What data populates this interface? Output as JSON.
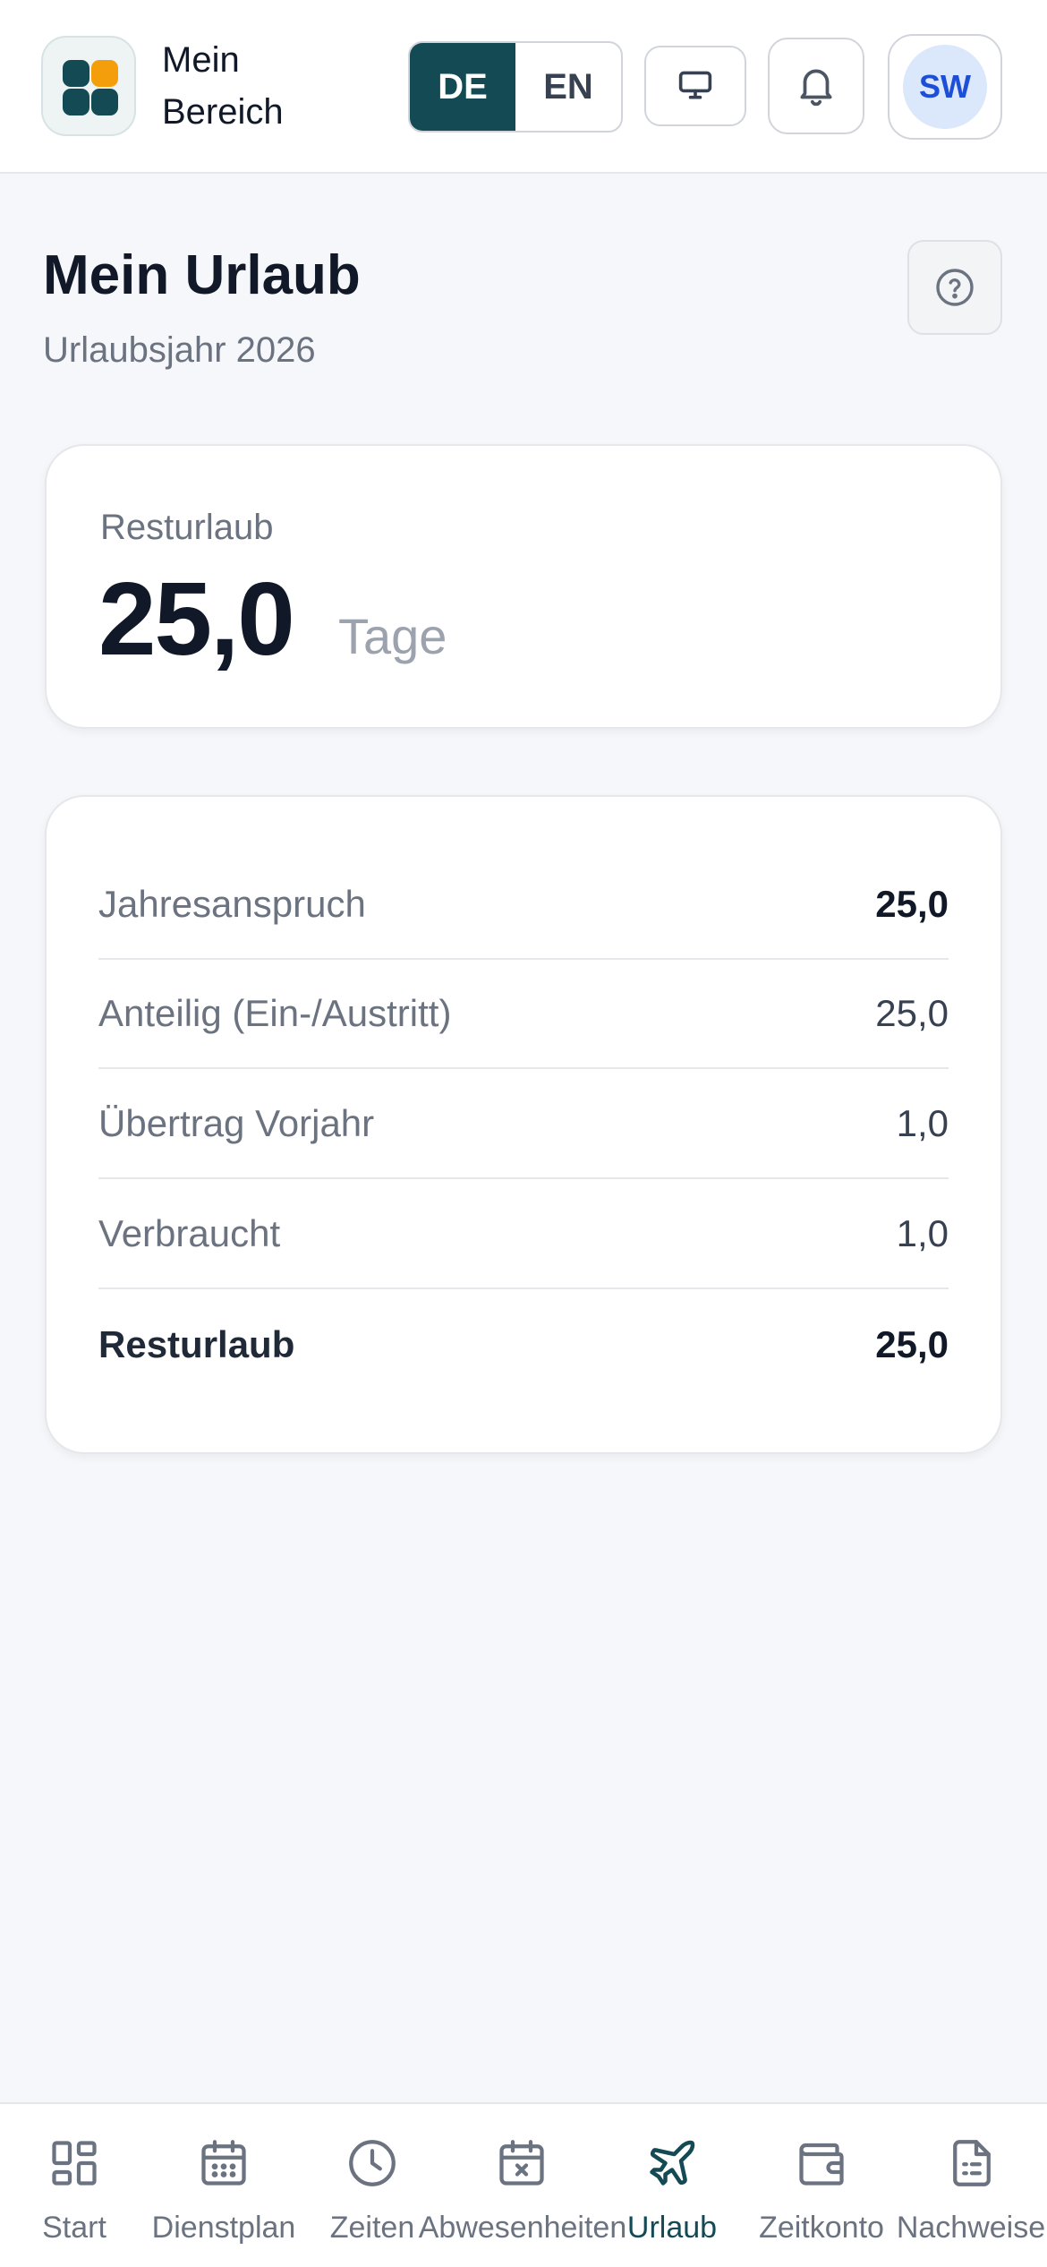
{
  "header": {
    "brand_line1": "Mein",
    "brand_line2": "Bereich",
    "lang_de": "DE",
    "lang_en": "EN",
    "active_lang": "DE",
    "avatar_initials": "SW"
  },
  "page": {
    "title": "Mein Urlaub",
    "subtitle": "Urlaubsjahr 2026"
  },
  "summary": {
    "label": "Resturlaub",
    "value": "25,0",
    "unit": "Tage"
  },
  "details": {
    "rows": [
      {
        "label": "Jahresanspruch",
        "value": "25,0"
      },
      {
        "label": "Anteilig (Ein-/Austritt)",
        "value": "25,0"
      },
      {
        "label": "Übertrag Vorjahr",
        "value": "1,0"
      },
      {
        "label": "Verbraucht",
        "value": "1,0"
      },
      {
        "label": "Resturlaub",
        "value": "25,0"
      }
    ]
  },
  "nav": {
    "items": [
      {
        "label": "Start",
        "icon": "grid-icon"
      },
      {
        "label": "Dienstplan",
        "icon": "calendar-grid-icon"
      },
      {
        "label": "Zeiten",
        "icon": "clock-icon"
      },
      {
        "label": "Abwesenheiten",
        "icon": "calendar-x-icon"
      },
      {
        "label": "Urlaub",
        "icon": "plane-icon"
      },
      {
        "label": "Zeitkonto",
        "icon": "wallet-icon"
      },
      {
        "label": "Nachweise",
        "icon": "document-icon"
      }
    ],
    "active": "Urlaub"
  },
  "colors": {
    "brand": "#134a54",
    "accent": "#f59e0b",
    "avatar_bg": "#dbe7fb",
    "avatar_text": "#1d4ed8"
  }
}
